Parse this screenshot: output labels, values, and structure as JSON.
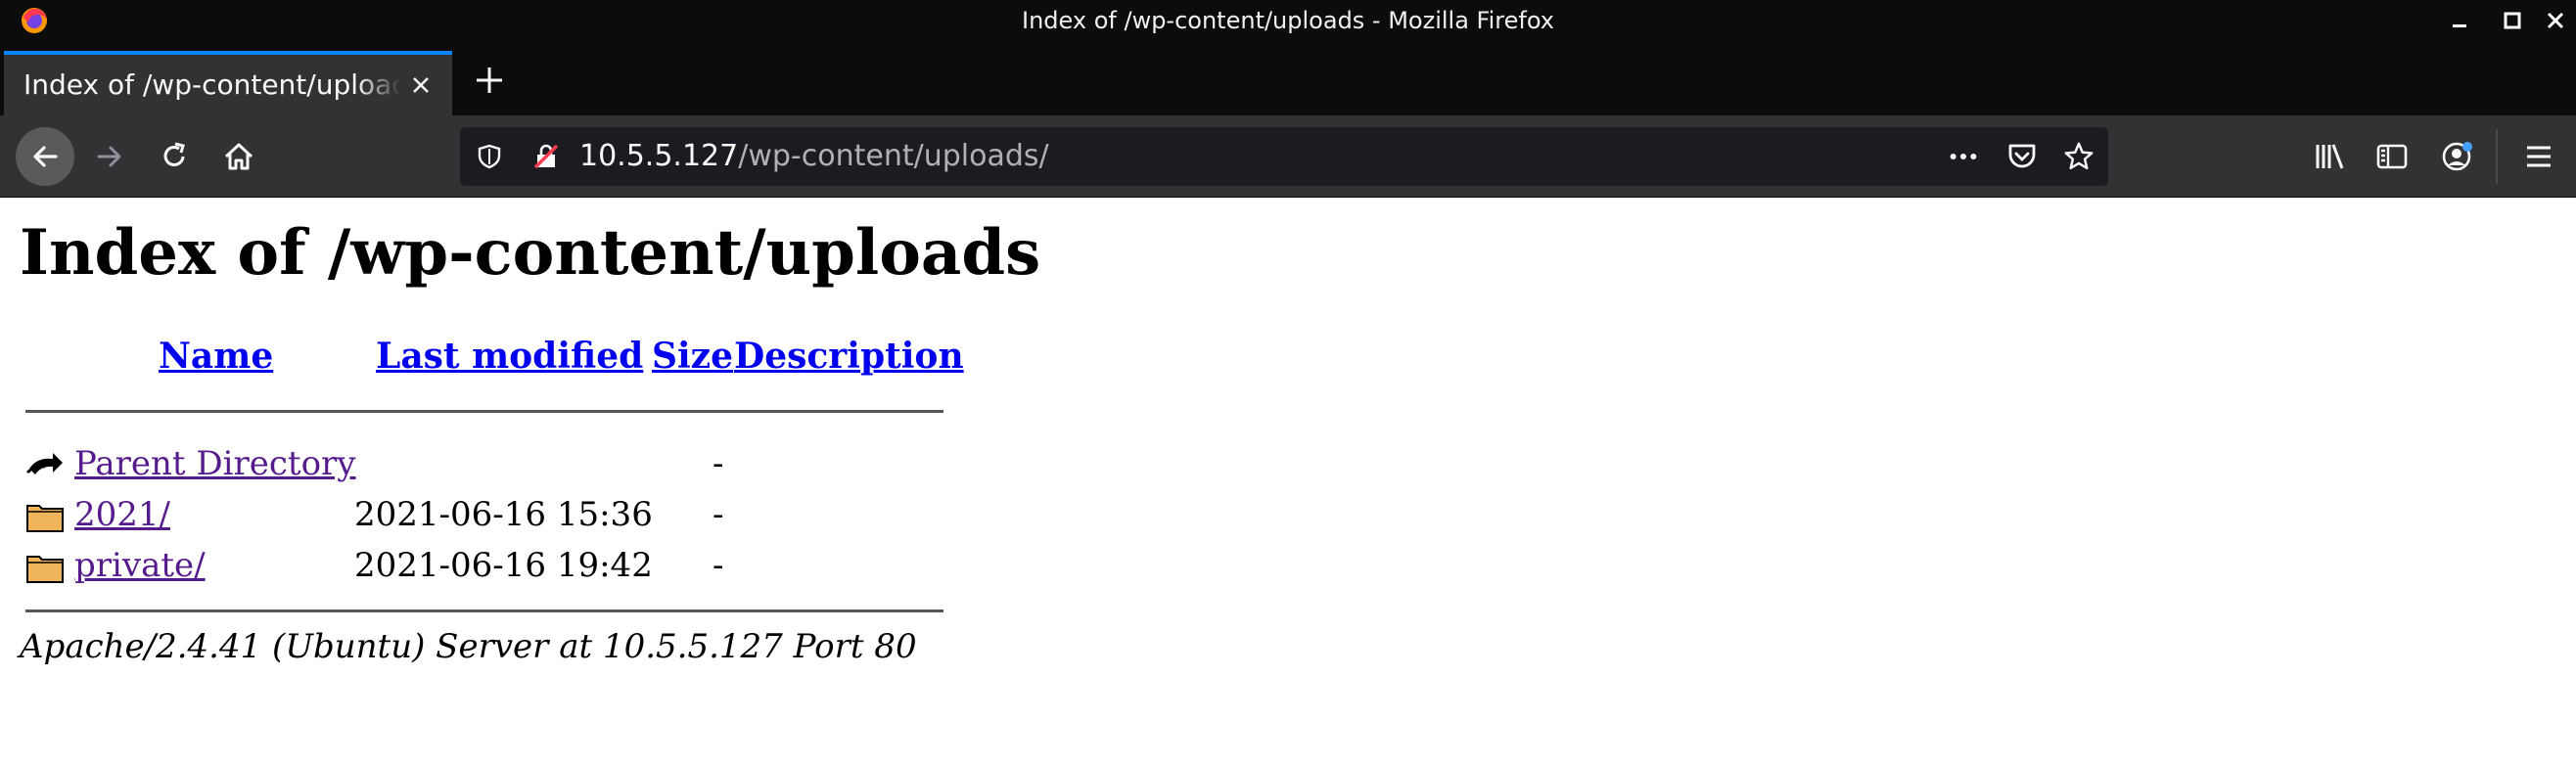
{
  "window": {
    "title": "Index of /wp-content/uploads - Mozilla Firefox",
    "controls": [
      "minimize-icon",
      "maximize-icon",
      "close-icon"
    ]
  },
  "tabs": [
    {
      "title": "Index of /wp-content/uploads",
      "active": true
    }
  ],
  "navbar": {
    "url_host": "10.5.5.127",
    "url_path": "/wp-content/uploads/",
    "left_icons": [
      "back-icon",
      "forward-icon",
      "reload-icon",
      "home-icon"
    ],
    "url_icons": [
      "tracking-shield-icon",
      "insecure-lock-icon",
      "page-actions-icon",
      "pocket-icon",
      "bookmark-star-icon"
    ],
    "right_icons": [
      "library-icon",
      "sidebar-icon",
      "account-icon",
      "menu-icon"
    ]
  },
  "page": {
    "heading": "Index of /wp-content/uploads",
    "columns": {
      "name": "Name",
      "last_modified": "Last modified",
      "size": "Size",
      "description": "Description"
    },
    "entries": [
      {
        "icon": "parent-directory-icon",
        "name": "Parent Directory",
        "modified": "",
        "size": "-"
      },
      {
        "icon": "folder-icon",
        "name": "2021/",
        "modified": "2021-06-16 15:36",
        "size": "-"
      },
      {
        "icon": "folder-icon",
        "name": "private/",
        "modified": "2021-06-16 19:42",
        "size": "-"
      }
    ],
    "address": "Apache/2.4.41 (Ubuntu) Server at 10.5.5.127 Port 80"
  },
  "colors": {
    "chrome_dark": "#0c0c0d",
    "toolbar": "#323234",
    "urlbar": "#1c1b22",
    "accent": "#0a84ff",
    "link": "#0000ee",
    "visited_link": "#551a8b"
  }
}
